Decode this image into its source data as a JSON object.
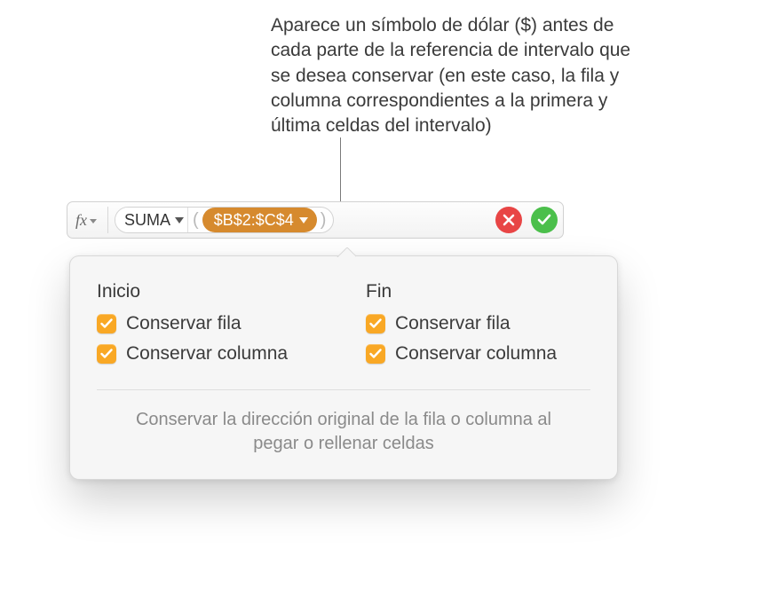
{
  "callout": {
    "text": "Aparece un símbolo de dólar ($) antes de cada parte de la referencia de intervalo que se desea conservar (en este caso, la fila y columna correspondientes a la primera y última celdas del intervalo)"
  },
  "formula_bar": {
    "fx_label": "fx",
    "function_name": "SUMA",
    "paren_open": "(",
    "paren_close": ")",
    "range_reference": "$B$2:$C$4"
  },
  "popover": {
    "start": {
      "title": "Inicio",
      "preserve_row": {
        "label": "Conservar fila",
        "checked": true
      },
      "preserve_col": {
        "label": "Conservar columna",
        "checked": true
      }
    },
    "end": {
      "title": "Fin",
      "preserve_row": {
        "label": "Conservar fila",
        "checked": true
      },
      "preserve_col": {
        "label": "Conservar columna",
        "checked": true
      }
    },
    "description": "Conservar la dirección original de la fila o columna al pegar o rellenar celdas"
  },
  "icons": {
    "fx": "fx-icon",
    "cancel": "cancel-icon",
    "confirm": "confirm-icon",
    "check": "checkmark-icon",
    "dropdown": "chevron-down-icon"
  }
}
